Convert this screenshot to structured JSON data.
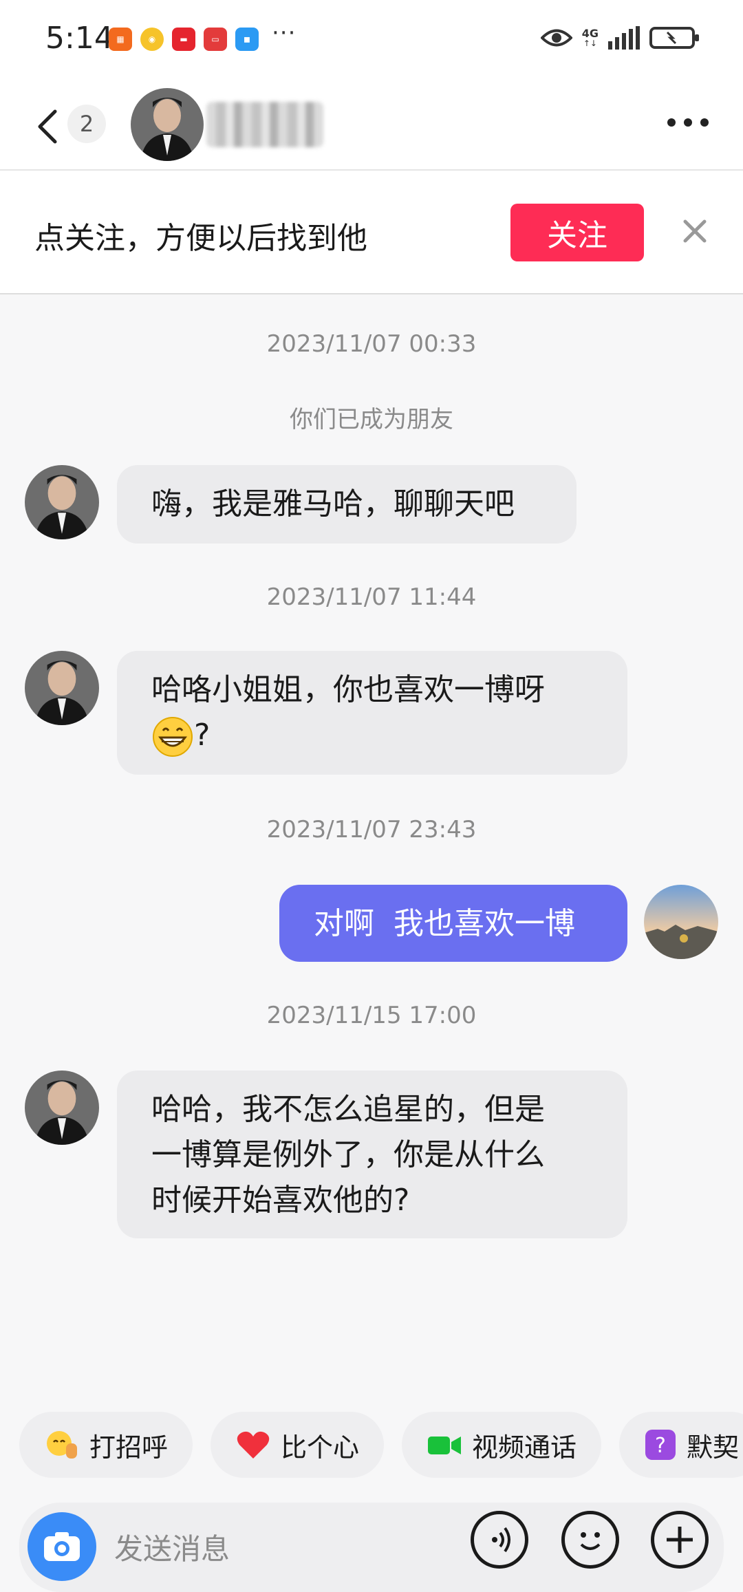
{
  "status_bar": {
    "time": "5:14",
    "more": "···",
    "network": "4G"
  },
  "header": {
    "unread_count": "2"
  },
  "follow_bar": {
    "prompt": "点关注，方便以后找到他",
    "follow_label": "关注"
  },
  "messages": [
    {
      "timestamp": "2023/11/07 00:33",
      "system": "你们已成为朋友",
      "text": "嗨，我是雅马哈，聊聊天吧"
    },
    {
      "timestamp": "2023/11/07 11:44",
      "line1": "哈咯小姐姐，你也喜欢一博呀",
      "line2_suffix": "?"
    },
    {
      "timestamp": "2023/11/07 23:43",
      "text": "对啊  我也喜欢一博"
    },
    {
      "timestamp": "2023/11/15 17:00",
      "line1": "哈哈，我不怎么追星的，但是",
      "line2": "一博算是例外了，你是从什么",
      "line3": "时候开始喜欢他的?"
    }
  ],
  "quick_actions": [
    {
      "label": "打招呼",
      "icon": "wave-emoji-icon"
    },
    {
      "label": "比个心",
      "icon": "heart-icon"
    },
    {
      "label": "视频通话",
      "icon": "video-camera-icon"
    },
    {
      "label": "默契",
      "icon": "question-box-icon"
    }
  ],
  "input": {
    "placeholder": "发送消息"
  },
  "colors": {
    "follow": "#fe2c55",
    "outgoing_bubble": "#6a6ff0",
    "camera": "#3a8cf7"
  }
}
